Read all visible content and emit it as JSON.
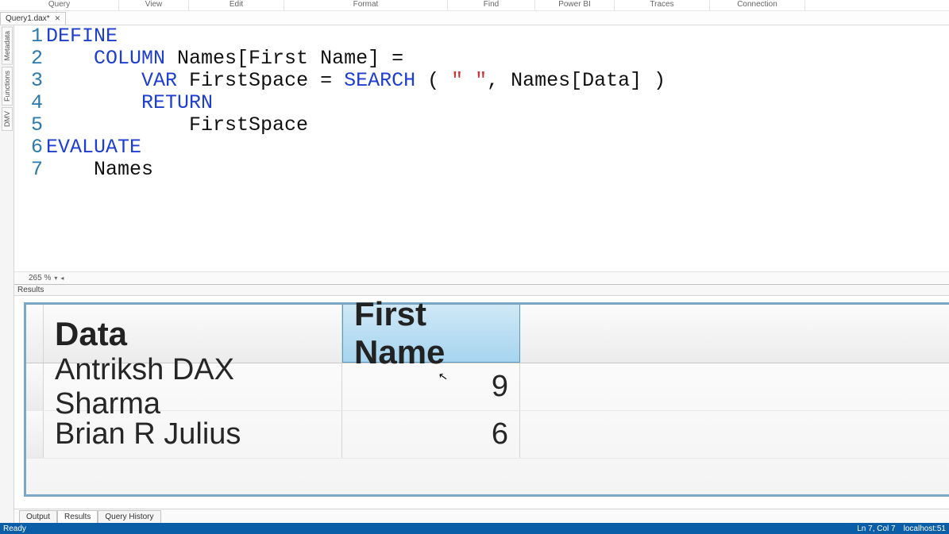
{
  "menu": {
    "items": [
      "Query",
      "View",
      "Edit",
      "Format",
      "Find",
      "Power BI",
      "Traces",
      "Connection"
    ],
    "widths": [
      150,
      88,
      120,
      206,
      110,
      100,
      120,
      120
    ]
  },
  "file_tab": {
    "name": "Query1.dax*",
    "close": "✕"
  },
  "side_tabs": [
    "Metadata",
    "Functions",
    "DMV"
  ],
  "editor": {
    "lines": [
      {
        "n": 1,
        "t": [
          [
            "DEFINE",
            "kw"
          ]
        ]
      },
      {
        "n": 2,
        "t": [
          [
            "    ",
            ""
          ],
          [
            "COLUMN",
            "kw"
          ],
          [
            " Names[First Name] =",
            ""
          ]
        ]
      },
      {
        "n": 3,
        "t": [
          [
            "        ",
            ""
          ],
          [
            "VAR",
            "kw"
          ],
          [
            " FirstSpace = ",
            ""
          ],
          [
            "SEARCH",
            "fn"
          ],
          [
            " ( ",
            ""
          ],
          [
            "\" \"",
            "str"
          ],
          [
            ", Names[Data] )",
            ""
          ]
        ]
      },
      {
        "n": 4,
        "t": [
          [
            "        ",
            ""
          ],
          [
            "RETURN",
            "kw"
          ]
        ]
      },
      {
        "n": 5,
        "t": [
          [
            "            FirstSpace",
            ""
          ]
        ]
      },
      {
        "n": 6,
        "t": [
          [
            "EVALUATE",
            "kw"
          ]
        ]
      },
      {
        "n": 7,
        "t": [
          [
            "    Names",
            ""
          ]
        ]
      }
    ],
    "zoom": "265 %"
  },
  "results": {
    "panel_label": "Results",
    "columns": [
      "Data",
      "First Name"
    ],
    "rows": [
      {
        "data": "Antriksh DAX Sharma",
        "first_name": "9"
      },
      {
        "data": "Brian R Julius",
        "first_name": "6"
      }
    ]
  },
  "bottom_tabs": [
    "Output",
    "Results",
    "Query History"
  ],
  "status": {
    "left": "Ready",
    "pos": "Ln 7, Col 7",
    "conn": "localhost:51"
  },
  "chart_data": {
    "type": "table",
    "title": "",
    "columns": [
      "Data",
      "First Name"
    ],
    "rows": [
      [
        "Antriksh DAX Sharma",
        9
      ],
      [
        "Brian R Julius",
        6
      ]
    ]
  }
}
